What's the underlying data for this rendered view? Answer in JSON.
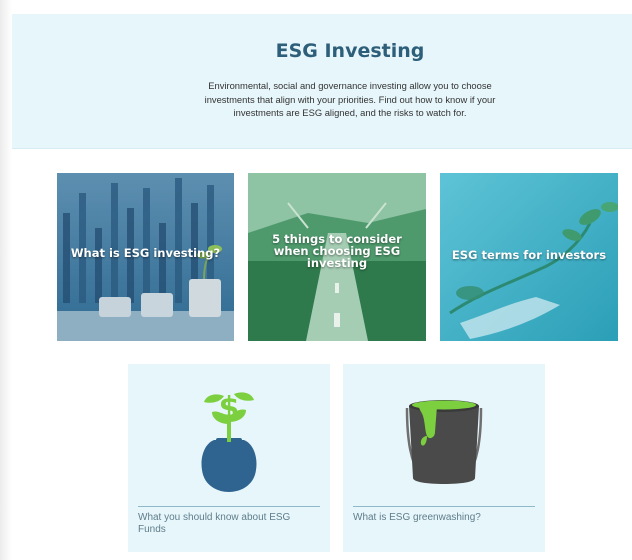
{
  "hero": {
    "title": "ESG Investing",
    "description": "Environmental, social and governance investing allow you to choose investments that align with your priorities. Find out how to know if your investments are ESG aligned, and the risks to watch for."
  },
  "feature_cards": [
    {
      "title": "What is ESG investing?",
      "overlay_color": "#3a7fa3"
    },
    {
      "title": "5 things to consider when choosing ESG investing",
      "overlay_color": "#2e8a5a"
    },
    {
      "title": "ESG terms for investors",
      "overlay_color": "#2aa7bf"
    }
  ],
  "article_tiles": [
    {
      "label": "What you should know about ESG Funds",
      "icon": "money-plant-bag-icon"
    },
    {
      "label": "What is ESG greenwashing?",
      "icon": "paint-bucket-icon"
    }
  ],
  "colors": {
    "hero_background": "#e7f6fb",
    "title_color": "#2e5f7a",
    "tile_background": "#e7f6fb",
    "icon_blue": "#2f6490",
    "icon_green": "#7ccf3f"
  }
}
